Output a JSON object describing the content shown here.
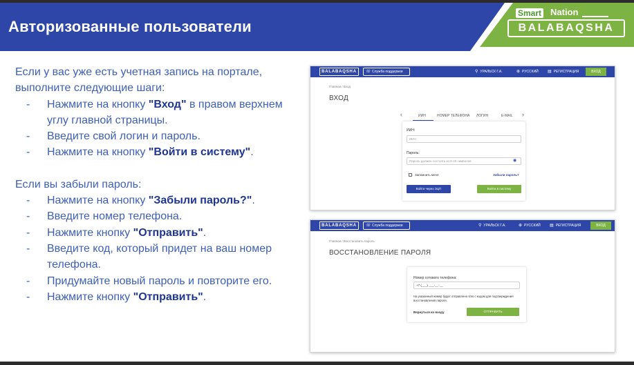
{
  "slide": {
    "title": "Авторизованные пользователи"
  },
  "logo": {
    "smart": "Smart",
    "nation": "Nation",
    "brand": "BALABAQSHA"
  },
  "colors": {
    "header_blue": "#2e46a8",
    "brand_green": "#7cb342",
    "text_blue": "#3d5fb8"
  },
  "left": {
    "intro1": "Если у вас уже есть учетная запись на портале, выполните следующие шаги:",
    "steps1": [
      {
        "text": "Нажмите на кнопку ",
        "bold": "\"Вход\"",
        "after": " в правом верхнем углу главной страницы."
      },
      {
        "text": "Введите свой логин и пароль.",
        "bold": "",
        "after": ""
      },
      {
        "text": "Нажмите на кнопку ",
        "bold": "\"Войти в систему\"",
        "after": "."
      }
    ],
    "intro2": "Если вы забыли пароль:",
    "steps2": [
      {
        "text": "Нажмите на кнопку ",
        "bold": "\"Забыли пароль?\"",
        "after": "."
      },
      {
        "text": "Введите номер телефона.",
        "bold": "",
        "after": ""
      },
      {
        "text": "Нажмите кнопку ",
        "bold": "\"Отправить\"",
        "after": "."
      },
      {
        "text": "Введите код, который придет на ваш номер телефона.",
        "bold": "",
        "after": ""
      },
      {
        "text": "Придумайте новый пароль и повторите его.",
        "bold": "",
        "after": ""
      },
      {
        "text": "Нажмите кнопку ",
        "bold": "\"Отправить\"",
        "after": "."
      }
    ]
  },
  "portal_nav": {
    "logo_small": "Smart Nation",
    "logo": "BALABAQSHA",
    "support": "Служба поддержки",
    "city": "УРАЛЬСК Г.А.",
    "language": "РУССКИЙ",
    "register": "РЕГИСТРАЦИЯ",
    "login": "ВХОД"
  },
  "login_screen": {
    "breadcrumb": "Главная  /  Вход",
    "heading": "ВХОД",
    "tabs": [
      "ИИН",
      "НОМЕР ТЕЛЕФОНА",
      "ЛОГИН",
      "E-MAIL"
    ],
    "iin_label": "ИИН:",
    "iin_placeholder": "ИИН",
    "password_label": "Пароль:",
    "password_placeholder": "Пароль должен состоять из 8-40 символов",
    "remember": "Запомнить меня",
    "forgot": "Забыли пароль?",
    "eds_button": "Войти через ЭЦП",
    "login_button": "Войти в систему"
  },
  "recover_screen": {
    "breadcrumb": "Главная  /  Восстановить пароль",
    "heading": "ВОССТАНОВЛЕНИЕ ПАРОЛЯ",
    "phone_label": "Номер сотового телефона:",
    "phone_value": "+7 (___) ___-__-__",
    "note": "На указанный номер будет отправлено sms с кодом для подтверждения восстановления пароля.",
    "back": "Вернуться ко входу",
    "send_button": "ОТПРАВИТЬ"
  }
}
